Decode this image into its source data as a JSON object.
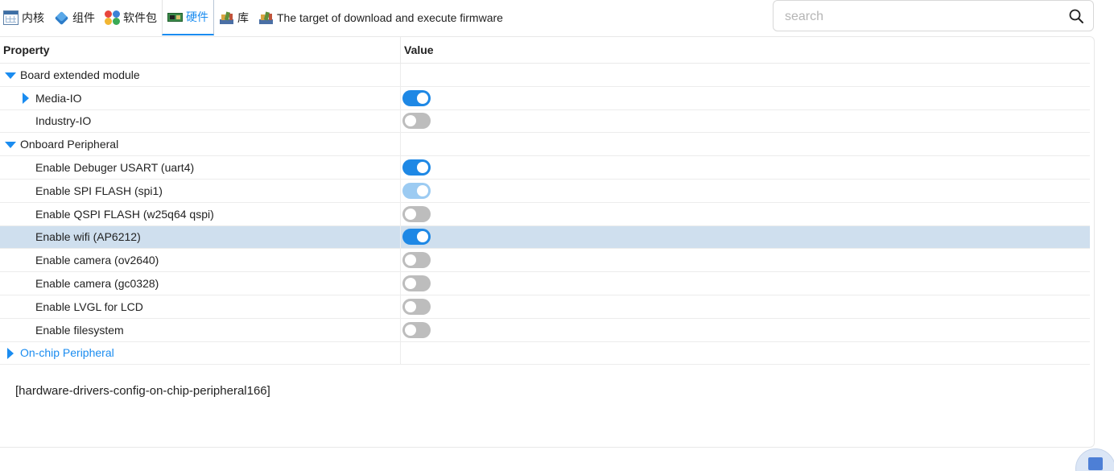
{
  "toolbar": {
    "tabs": [
      {
        "label": "内核",
        "icon": "table-grid-icon"
      },
      {
        "label": "组件",
        "icon": "cube-icon"
      },
      {
        "label": "软件包",
        "icon": "colored-dots-icon"
      },
      {
        "label": "硬件",
        "icon": "circuit-board-icon",
        "active": true
      },
      {
        "label": "库",
        "icon": "books-icon"
      },
      {
        "label": "The target of download and execute firmware",
        "icon": "books-icon"
      }
    ]
  },
  "search": {
    "placeholder": "search",
    "value": "",
    "icon": "magnifier-icon"
  },
  "grid": {
    "header": {
      "property": "Property",
      "value": "Value"
    },
    "rows": [
      {
        "label": "Board extended module",
        "level": 0,
        "expander": "expanded",
        "toggle": null
      },
      {
        "label": "Media-IO",
        "level": 1,
        "expander": "collapsed",
        "toggle": "on"
      },
      {
        "label": "Industry-IO",
        "level": 1,
        "expander": null,
        "toggle": "off"
      },
      {
        "label": "Onboard Peripheral",
        "level": 0,
        "expander": "expanded",
        "toggle": null
      },
      {
        "label": "Enable Debuger USART (uart4)",
        "level": 1,
        "expander": null,
        "toggle": "on"
      },
      {
        "label": "Enable SPI FLASH (spi1)",
        "level": 1,
        "expander": null,
        "toggle": "on-disabled"
      },
      {
        "label": "Enable QSPI FLASH (w25q64 qspi)",
        "level": 1,
        "expander": null,
        "toggle": "off"
      },
      {
        "label": "Enable wifi (AP6212)",
        "level": 1,
        "expander": null,
        "toggle": "on",
        "selected": true
      },
      {
        "label": "Enable camera (ov2640)",
        "level": 1,
        "expander": null,
        "toggle": "off"
      },
      {
        "label": "Enable camera (gc0328)",
        "level": 1,
        "expander": null,
        "toggle": "off"
      },
      {
        "label": "Enable LVGL for LCD",
        "level": 1,
        "expander": null,
        "toggle": "off"
      },
      {
        "label": "Enable filesystem",
        "level": 1,
        "expander": null,
        "toggle": "off"
      },
      {
        "label": "On-chip Peripheral",
        "level": 0,
        "expander": "collapsed",
        "toggle": null,
        "link": true
      }
    ]
  },
  "description": "[hardware-drivers-config-on-chip-peripheral166]",
  "colors": {
    "accent": "#1a8cf0",
    "toggle_on": "#1e88e5",
    "toggle_off": "#bdbdbd",
    "selected_row": "#cfdfee"
  },
  "fab": {
    "icon": "device-icon"
  }
}
